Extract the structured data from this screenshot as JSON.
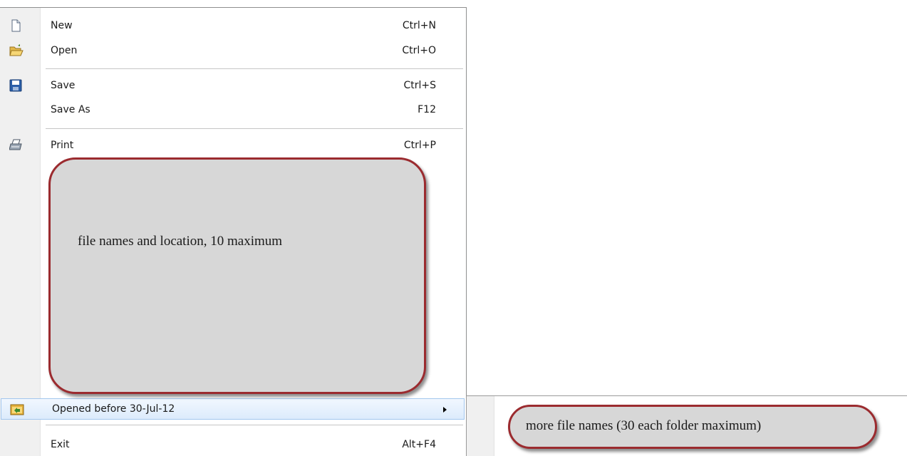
{
  "menu": {
    "items": [
      {
        "label": "New",
        "shortcut": "Ctrl+N",
        "icon": "new-document-icon"
      },
      {
        "label": "Open",
        "shortcut": "Ctrl+O",
        "icon": "open-folder-icon"
      },
      {
        "label": "Save",
        "shortcut": "Ctrl+S",
        "icon": "save-disk-icon"
      },
      {
        "label": "Save As",
        "shortcut": "F12",
        "icon": ""
      },
      {
        "label": "Print",
        "shortcut": "Ctrl+P",
        "icon": "printer-icon"
      },
      {
        "label": "Opened before 30-Jul-12",
        "shortcut": "",
        "icon": "recent-folder-icon"
      },
      {
        "label": "Exit",
        "shortcut": "Alt+F4",
        "icon": ""
      }
    ]
  },
  "annotations": {
    "recent_files": "file names and location, 10 maximum",
    "submenu_files": "more file names (30 each folder maximum)"
  },
  "colors": {
    "callout_fill": "#d7d7d7",
    "callout_border": "#9b2b2f",
    "highlight_border": "#a3c7ee",
    "gutter": "#f0f0f0"
  }
}
